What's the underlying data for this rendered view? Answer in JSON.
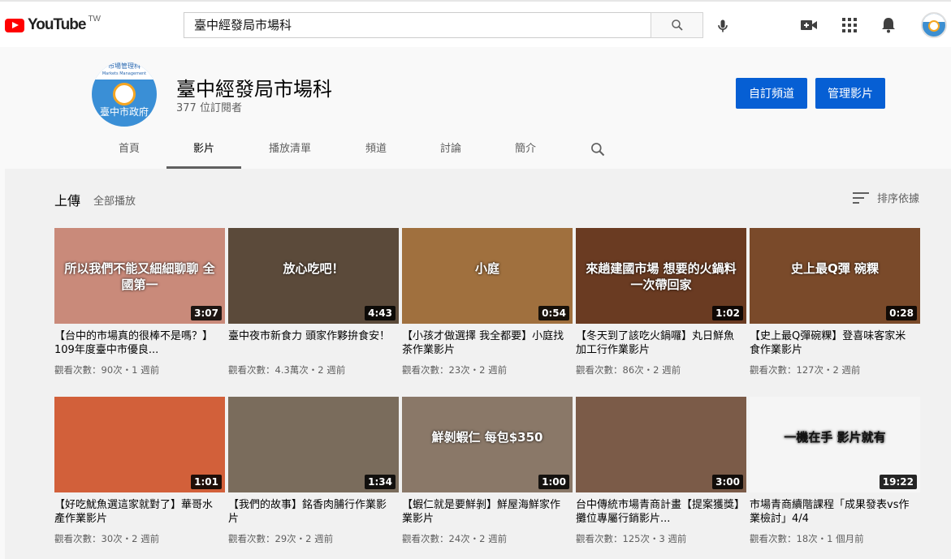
{
  "topbar": {
    "logo_text": "YouTube",
    "region": "TW",
    "search_value": "臺中經發局市場科"
  },
  "channel": {
    "name": "臺中經發局市場科",
    "subscribers": "377 位訂閱者",
    "avatar_top": "市場管理科",
    "avatar_sub": "Markets Management",
    "avatar_bottom": "臺中市政府",
    "subscribe_label": "自訂頻道",
    "manage_label": "管理影片"
  },
  "tabs": [
    "首頁",
    "影片",
    "播放清單",
    "頻道",
    "討論",
    "簡介"
  ],
  "active_tab": "影片",
  "section": {
    "title": "上傳",
    "play_all": "全部播放",
    "sort_label": "排序依據"
  },
  "videos": [
    {
      "title": "【台中的市場真的很棒不是嗎？】109年度臺中市優良...",
      "meta": "觀看次數：90次・1 週前",
      "duration": "3:07",
      "thumb_color": "#c98a7a",
      "overlay": "所以我們不能又細細聊聊 全國第一"
    },
    {
      "title": "臺中夜市新食力 頭家作夥拚食安！",
      "meta": "觀看次數：4.3萬次・2 週前",
      "duration": "4:43",
      "thumb_color": "#5b4a3a",
      "overlay": "放心吃吧！"
    },
    {
      "title": "【小孩才做選擇 我全都要】小庭找茶作業影片",
      "meta": "觀看次數：23次・2 週前",
      "duration": "0:54",
      "thumb_color": "#a0703e",
      "overlay": "小庭"
    },
    {
      "title": "【冬天到了該吃火鍋囉】丸日鮮魚加工行作業影片",
      "meta": "觀看次數：86次・2 週前",
      "duration": "1:02",
      "thumb_color": "#6a3b22",
      "overlay": "來趟建國市場 想要的火鍋料一次帶回家"
    },
    {
      "title": "【史上最Q彈碗粿】登喜味客家米食作業影片",
      "meta": "觀看次數：127次・2 週前",
      "duration": "0:28",
      "thumb_color": "#7a4a2a",
      "overlay": "史上最Q彈 碗粿"
    },
    {
      "title": "【好吃魷魚選這家就對了】華哥水產作業影片",
      "meta": "觀看次數：30次・2 週前",
      "duration": "1:01",
      "thumb_color": "#d2603a",
      "overlay": ""
    },
    {
      "title": "【我們的故事】銘香肉脯行作業影片",
      "meta": "觀看次數：29次・2 週前",
      "duration": "1:34",
      "thumb_color": "#7a6c5c",
      "overlay": ""
    },
    {
      "title": "【蝦仁就是要鮮剝】鮮屋海鮮家作業影片",
      "meta": "觀看次數：24次・2 週前",
      "duration": "1:00",
      "thumb_color": "#8a7868",
      "overlay": "鮮剝蝦仁 每包$350"
    },
    {
      "title": "台中傳統市場青商計畫【提案獲獎】攤位專屬行銷影片...",
      "meta": "觀看次數：125次・3 週前",
      "duration": "3:00",
      "thumb_color": "#7b5b48",
      "overlay": ""
    },
    {
      "title": "市場青商續階課程「成果發表vs作業檢討」4/4",
      "meta": "觀看次數：18次・1 個月前",
      "duration": "19:22",
      "thumb_color": "#f5f5f5",
      "overlay": "一機在手 影片就有"
    }
  ]
}
